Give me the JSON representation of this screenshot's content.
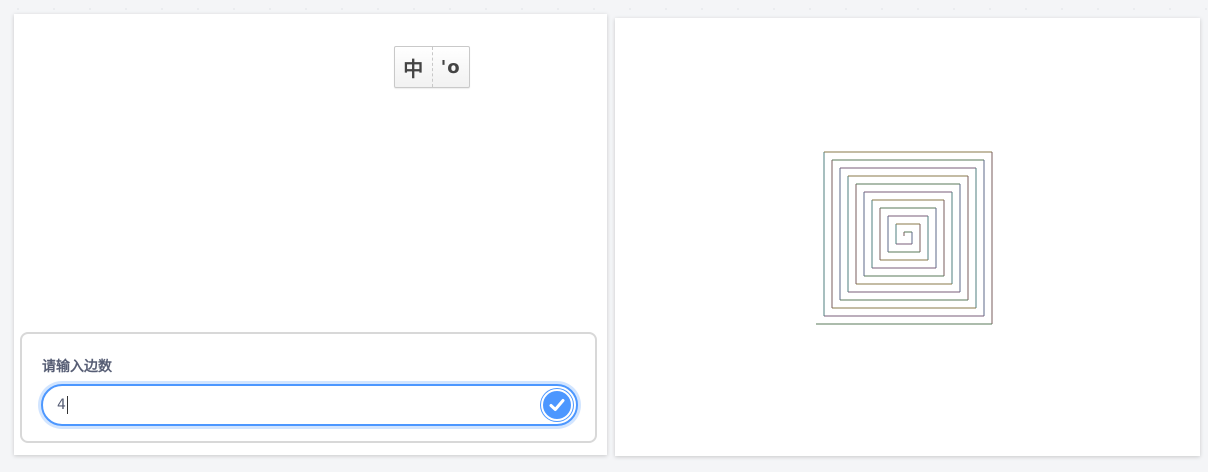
{
  "ime": {
    "mode_label": "中",
    "punct_label": "'o"
  },
  "ask": {
    "prompt": "请输入边数",
    "value": "4",
    "submit_icon": "check-icon"
  },
  "stage": {
    "drawing": "square-spiral",
    "pen_colors": [
      "#7a5c5c",
      "#5a7a5a",
      "#5c6a8a",
      "#7a5c7a",
      "#4f7f7f",
      "#8a7a4a"
    ]
  }
}
